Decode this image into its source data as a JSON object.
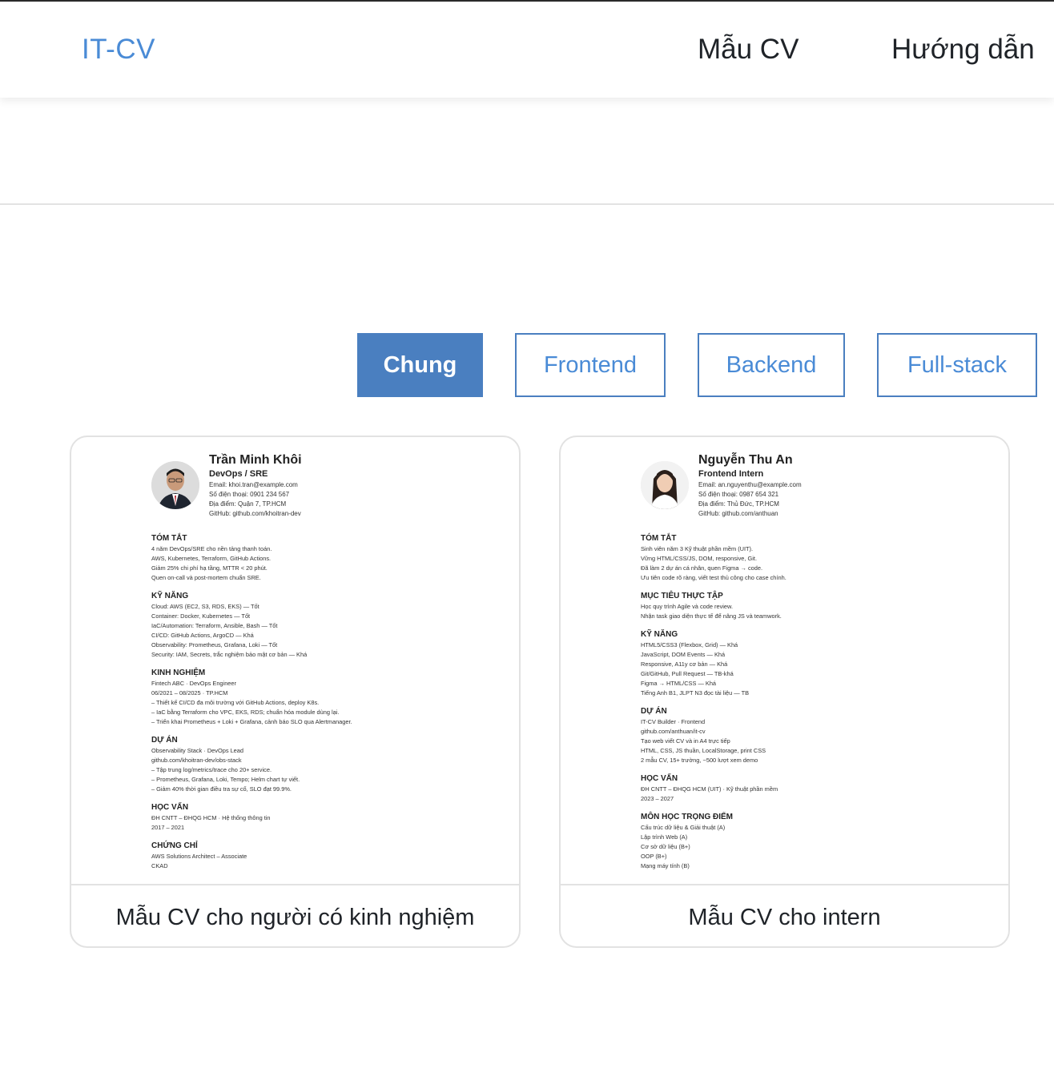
{
  "header": {
    "brand": "IT-CV",
    "nav": {
      "templates": "Mẫu CV",
      "guide": "Hướng dẫn"
    }
  },
  "tabs": {
    "general": "Chung",
    "frontend": "Frontend",
    "backend": "Backend",
    "fullstack": "Full-stack",
    "active": "general"
  },
  "cards": {
    "experienced": {
      "caption": "Mẫu CV cho người có kinh nghiệm",
      "cv": {
        "name": "Trần Minh Khôi",
        "role": "DevOps / SRE",
        "contact": [
          "Email: khoi.tran@example.com",
          "Số điện thoại: 0901 234 567",
          "Địa điểm: Quận 7, TP.HCM",
          "GitHub: github.com/khoitran-dev"
        ],
        "sections": [
          {
            "title": "TÓM TẮT",
            "lines": [
              "4 năm DevOps/SRE cho nền tảng thanh toán.",
              "AWS, Kubernetes, Terraform, GitHub Actions.",
              "Giảm 25% chi phí hạ tầng, MTTR < 20 phút.",
              "Quen on-call và post-mortem chuẩn SRE."
            ]
          },
          {
            "title": "KỸ NĂNG",
            "lines": [
              "Cloud: AWS (EC2, S3, RDS, EKS) — Tốt",
              "Container: Docker, Kubernetes — Tốt",
              "IaC/Automation: Terraform, Ansible, Bash — Tốt",
              "CI/CD: GitHub Actions, ArgoCD — Khá",
              "Observability: Prometheus, Grafana, Loki — Tốt",
              "Security: IAM, Secrets, trắc nghiệm bảo mật cơ bản — Khá"
            ]
          },
          {
            "title": "KINH NGHIỆM",
            "lines": [
              "Fintech ABC · DevOps Engineer",
              "06/2021 – 08/2025 · TP.HCM",
              "– Thiết kế CI/CD đa môi trường với GitHub Actions, deploy K8s.",
              "– IaC bằng Terraform cho VPC, EKS, RDS; chuẩn hóa module dùng lại.",
              "– Triển khai Prometheus + Loki + Grafana, cảnh báo SLO qua Alertmanager."
            ]
          },
          {
            "title": "DỰ ÁN",
            "lines": [
              "Observability Stack · DevOps Lead",
              "github.com/khoitran-dev/obs-stack",
              "– Tập trung log/metrics/trace cho 20+ service.",
              "– Prometheus, Grafana, Loki, Tempo; Helm chart tự viết.",
              "– Giảm 40% thời gian điều tra sự cố, SLO đạt 99.9%."
            ]
          },
          {
            "title": "HỌC VẤN",
            "lines": [
              "ĐH CNTT – ĐHQG HCM · Hệ thống thông tin",
              "2017 – 2021"
            ]
          },
          {
            "title": "CHỨNG CHỈ",
            "lines": [
              "AWS Solutions Architect – Associate",
              "CKAD"
            ]
          }
        ]
      }
    },
    "intern": {
      "caption": "Mẫu CV cho intern",
      "cv": {
        "name": "Nguyễn Thu An",
        "role": "Frontend Intern",
        "contact": [
          "Email: an.nguyenthu@example.com",
          "Số điện thoại: 0987 654 321",
          "Địa điểm: Thủ Đức, TP.HCM",
          "GitHub: github.com/anthuan"
        ],
        "sections": [
          {
            "title": "TÓM TẮT",
            "lines": [
              "Sinh viên năm 3 Kỹ thuật phần mềm (UIT).",
              "Vững HTML/CSS/JS, DOM, responsive, Git.",
              "Đã làm 2 dự án cá nhân, quen Figma → code.",
              "Ưu tiên code rõ ràng, viết test thủ công cho case chính."
            ]
          },
          {
            "title": "MỤC TIÊU THỰC TẬP",
            "lines": [
              "Học quy trình Agile và code review.",
              "Nhận task giao diện thực tế để nâng JS và teamwork."
            ]
          },
          {
            "title": "KỸ NĂNG",
            "lines": [
              "HTML5/CSS3 (Flexbox, Grid) — Khá",
              "JavaScript, DOM Events — Khá",
              "Responsive, A11y cơ bản — Khá",
              "Git/GitHub, Pull Request — TB-khá",
              "Figma → HTML/CSS — Khá",
              "Tiếng Anh B1, JLPT N3 đọc tài liệu — TB"
            ]
          },
          {
            "title": "DỰ ÁN",
            "lines": [
              "IT-CV Builder · Frontend",
              "github.com/anthuan/it-cv",
              "Tạo web viết CV và in A4 trực tiếp",
              "HTML, CSS, JS thuần, LocalStorage, print CSS",
              "2 mẫu CV, 15+ trường, ~500 lượt xem demo"
            ]
          },
          {
            "title": "HỌC VẤN",
            "lines": [
              "ĐH CNTT – ĐHQG HCM (UIT) · Kỹ thuật phần mềm",
              "2023 – 2027"
            ]
          },
          {
            "title": "MÔN HỌC TRỌNG ĐIỂM",
            "lines": [
              "Cấu trúc dữ liệu & Giải thuật (A)",
              "Lập trình Web (A)",
              "Cơ sở dữ liệu (B+)",
              "OOP (B+)",
              "Mạng máy tính (B)"
            ]
          }
        ]
      }
    }
  },
  "colors": {
    "accent": "#4a8bd6",
    "tab_active_bg": "#4a7fc0"
  }
}
